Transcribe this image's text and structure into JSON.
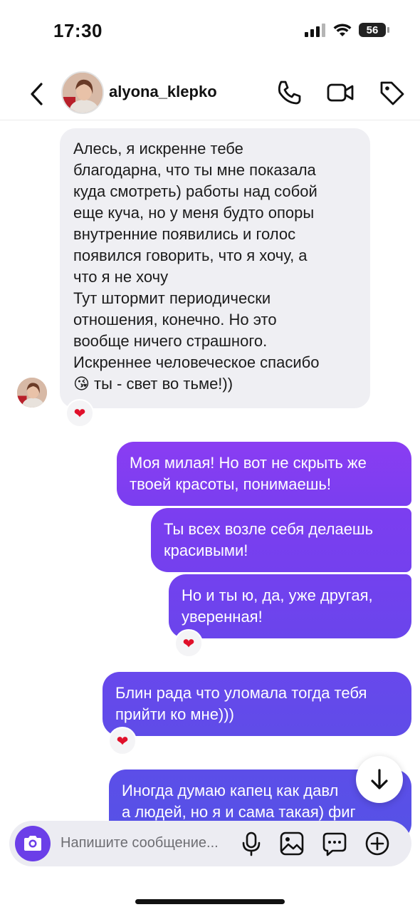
{
  "status": {
    "time": "17:30",
    "battery": "56"
  },
  "header": {
    "username": "alyona_klepko"
  },
  "messages": [
    {
      "text": "Алесь, я искренне тебе\nблагодарна, что ты мне показала\nкуда смотреть) работы над собой\nеще куча, но у меня будто опоры\nвнутренние появились и голос\nпоявился говорить, что я хочу, а\nчто я не хочу",
      "reaction": "❤"
    },
    {
      "text": "Тут штормит периодически\nотношения, конечно. Но это\nвообще ничего страшного.\nИскреннее человеческое спасибо\n😘 ты - свет во тьме!))"
    },
    {
      "text": "Моя милая! Но вот не скрыть же\nтвоей красоты, понимаешь!"
    },
    {
      "text": "Ты всех возле себя делаешь\nкрасивыми!"
    },
    {
      "text": "Но и ты ю, да, уже другая,\nуверенная!",
      "reaction": "❤"
    },
    {
      "text": "Блин рада что уломала тогда тебя\nприйти ко мне)))",
      "reaction": "❤"
    },
    {
      "text": "Иногда думаю капец как давл\nа людей, но я и сама такая) фиг"
    }
  ],
  "composer": {
    "placeholder": "Напишите сообщение..."
  },
  "colors": {
    "accent": "#6b3fe8",
    "bubble_out_top": "#7a3ef0",
    "bubble_out_bottom": "#5a4ee6",
    "bubble_in": "#efeff3"
  }
}
